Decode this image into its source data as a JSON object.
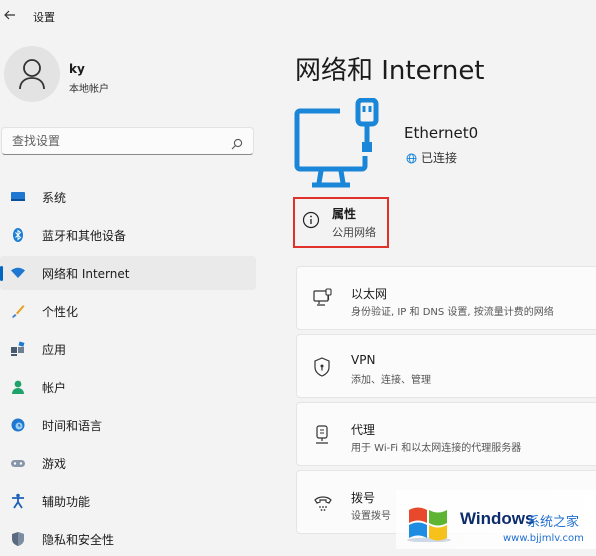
{
  "window": {
    "title": "设置"
  },
  "user": {
    "name": "ky",
    "account_type": "本地帐户"
  },
  "search": {
    "placeholder": "查找设置"
  },
  "sidebar": {
    "items": [
      {
        "label": "系统",
        "icon": "monitor-icon"
      },
      {
        "label": "蓝牙和其他设备",
        "icon": "bluetooth-icon"
      },
      {
        "label": "网络和 Internet",
        "icon": "wifi-icon",
        "active": true
      },
      {
        "label": "个性化",
        "icon": "brush-icon"
      },
      {
        "label": "应用",
        "icon": "apps-icon"
      },
      {
        "label": "帐户",
        "icon": "person-icon"
      },
      {
        "label": "时间和语言",
        "icon": "globe-clock-icon"
      },
      {
        "label": "游戏",
        "icon": "gamepad-icon"
      },
      {
        "label": "辅助功能",
        "icon": "accessibility-icon"
      },
      {
        "label": "隐私和安全性",
        "icon": "shield-icon"
      }
    ]
  },
  "main": {
    "title": "网络和 Internet",
    "adapter": {
      "name": "Ethernet0",
      "status": "已连接"
    },
    "properties": {
      "title": "属性",
      "subtitle": "公用网络"
    },
    "cards": [
      {
        "title": "以太网",
        "subtitle": "身份验证, IP 和 DNS 设置, 按流量计费的网络",
        "icon": "ethernet-icon"
      },
      {
        "title": "VPN",
        "subtitle": "添加、连接、管理",
        "icon": "vpn-shield-icon"
      },
      {
        "title": "代理",
        "subtitle": "用于 Wi-Fi 和以太网连接的代理服务器",
        "icon": "proxy-icon"
      },
      {
        "title": "拨号",
        "subtitle": "设置拨号",
        "icon": "dialup-icon"
      }
    ]
  },
  "watermark": {
    "brand": "Windows",
    "cn": "系统之家",
    "url": "www.bjjmlv.com"
  },
  "colors": {
    "accent": "#0067c0",
    "highlight_border": "#e0312a",
    "device_icon": "#1a86d8"
  }
}
